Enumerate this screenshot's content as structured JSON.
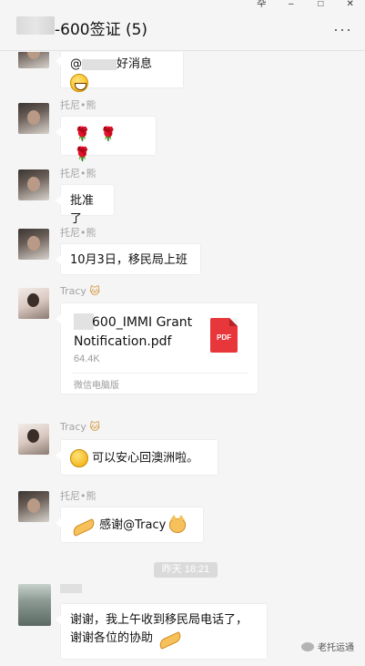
{
  "window": {
    "pin": "卆",
    "minimize": "–",
    "maximize": "□",
    "close": "✕"
  },
  "header": {
    "title": "-600签证 (5)",
    "more": "···"
  },
  "messages": {
    "m1": {
      "text_prefix": "@",
      "text_suffix": "好消息"
    },
    "m2": {
      "sender": "托尼•熊",
      "roses": [
        "🌹",
        "🌹",
        "🌹"
      ]
    },
    "m3": {
      "sender": "托尼•熊",
      "text": "批准了"
    },
    "m4": {
      "sender": "托尼•熊",
      "text": "10月3日，移民局上班"
    },
    "m5": {
      "sender": "Tracy",
      "sender_badge": "🐱",
      "file_name": "600_IMMI Grant Notification.pdf",
      "file_size": "64.4K",
      "file_source": "微信电脑版",
      "file_type": "PDF"
    },
    "m6": {
      "sender": "Tracy",
      "sender_badge": "🐱",
      "text": "可以安心回澳洲啦。"
    },
    "m7": {
      "sender": "托尼•熊",
      "text": "感谢@Tracy"
    },
    "time_divider": "昨天 18:21",
    "m8": {
      "text_line1": "谢谢，我上午收到移民局电话了，",
      "text_line2": "谢谢各位的协助"
    }
  },
  "watermark": "老托运通"
}
